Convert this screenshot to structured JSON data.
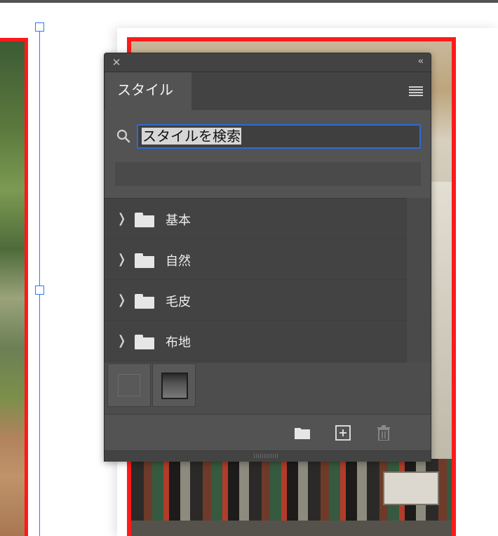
{
  "panel": {
    "tab_label": "スタイル",
    "collapse_label": "‹‹",
    "close_label": "✕"
  },
  "search": {
    "value": "スタイルを検索"
  },
  "style_groups": [
    {
      "label": "基本"
    },
    {
      "label": "自然"
    },
    {
      "label": "毛皮"
    },
    {
      "label": "布地"
    }
  ],
  "presets": [
    "none",
    "bevel"
  ],
  "icons": {
    "search": "search-icon",
    "new_group": "folder-icon",
    "new_style": "add-icon",
    "delete": "trash-icon"
  },
  "colors": {
    "panel_bg": "#535353",
    "focus": "#2b6bd8",
    "artboard_border": "#ff1a1a",
    "selection": "#2b7ce9"
  }
}
